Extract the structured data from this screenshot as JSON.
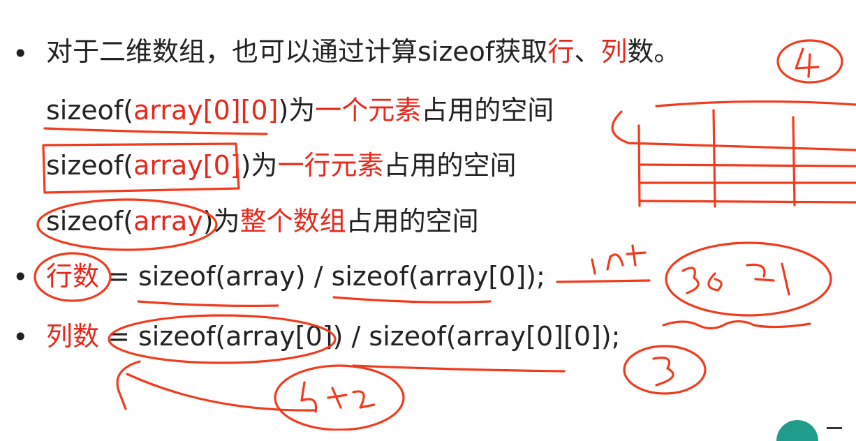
{
  "slide": {
    "line1": {
      "bullet": "•",
      "part1": "对于二维数组，也可以通过计算sizeof获取",
      "hang": "行",
      "sep": "、",
      "lie": "列",
      "part2": "数。"
    },
    "line2": {
      "code": "sizeof(",
      "arg": "array[0][0]",
      "close": ")",
      "wei": "为",
      "red": "一个元素",
      "rest": "占用的空间"
    },
    "line3": {
      "code": "sizeof(",
      "arg": "array[0]",
      "close": ")",
      "wei": "为",
      "red": "一行元素",
      "rest": "占用的空间"
    },
    "line4": {
      "code": "sizeof(",
      "arg": "array",
      "close": ")",
      "wei": "为",
      "red": "整个数组",
      "rest": "占用的空间"
    },
    "line5": {
      "bullet": "•",
      "red": "行数",
      "rest": " = sizeof(array) / sizeof(array[0]);"
    },
    "line6": {
      "bullet": "•",
      "red": "列数",
      "rest": " = sizeof(array[0]) / sizeof(array[0][0]);"
    }
  },
  "colors": {
    "text": "#222222",
    "accent_red": "#e8271b",
    "ink": "#f23a1d",
    "logo": "#1f9c8c"
  }
}
